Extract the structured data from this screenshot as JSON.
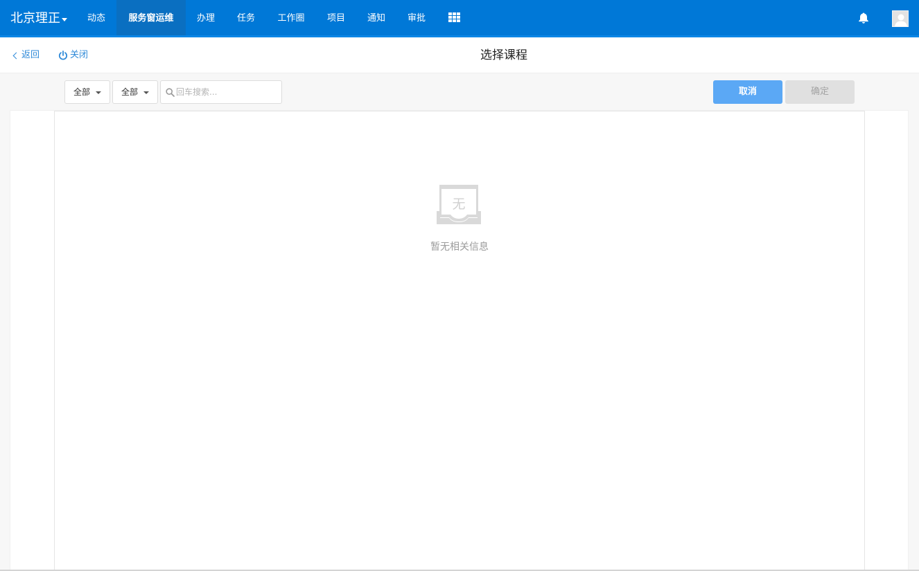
{
  "topnav": {
    "brand": "北京理正",
    "items": [
      {
        "label": "动态"
      },
      {
        "label": "服务窗运维"
      },
      {
        "label": "办理"
      },
      {
        "label": "任务"
      },
      {
        "label": "工作圈"
      },
      {
        "label": "项目"
      },
      {
        "label": "通知"
      },
      {
        "label": "审批"
      }
    ],
    "active_index": 1,
    "apps_icon": "grid-icon",
    "notification_icon": "bell-icon",
    "avatar_icon": "user-avatar-icon",
    "color": "#0078d7"
  },
  "subheader": {
    "back_label": "返回",
    "close_label": "关闭",
    "title": "选择课程"
  },
  "toolbar": {
    "filter1": "全部",
    "filter2": "全部",
    "search_placeholder": "回车搜索...",
    "cancel_label": "取消",
    "confirm_label": "确定",
    "cancel_color": "#5ba8f5"
  },
  "empty_state": {
    "icon_glyph": "无",
    "message": "暂无相关信息"
  }
}
